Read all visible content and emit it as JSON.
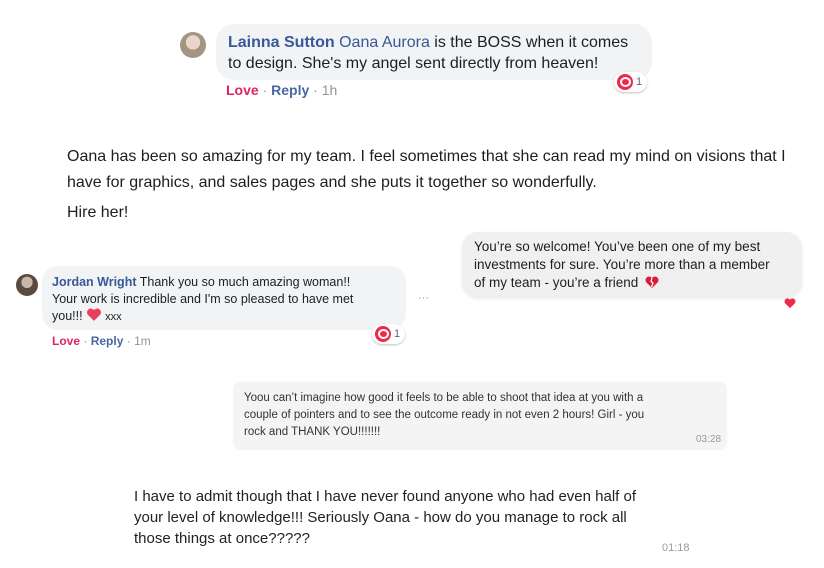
{
  "comment1": {
    "author": "Lainna Sutton",
    "mention": "Oana Aurora",
    "text_line1_rest": " is the BOSS when it comes",
    "text_line2": "to design. She's my angel sent directly from heaven!",
    "actions": {
      "love": "Love",
      "reply": "Reply",
      "time": "1h"
    },
    "reaction_count": "1"
  },
  "testimonial": {
    "line1": "Oana has been so amazing for my team. I feel sometimes that she can read my mind on visions that I",
    "line2": "have for graphics, and sales pages and she puts it together so wonderfully.",
    "line3": "Hire her!"
  },
  "reply_bubble": {
    "line1": "You’re so welcome!  You’ve been one of my best",
    "line2": "investments for sure.  You’re more than a member",
    "line3": "of my team - you’re a friend"
  },
  "comment2": {
    "author": "Jordan Wright",
    "text_line1_rest": " Thank you so much amazing woman!!",
    "text_line2": "Your work is incredible and I'm so pleased to have met",
    "text_line3": "you!!!",
    "text_line3_tail": " xxx",
    "ellipsis": "···",
    "actions": {
      "love": "Love",
      "reply": "Reply",
      "time": "1m"
    },
    "reaction_count": "1"
  },
  "message1": {
    "line1": "Yoou can’t imagine how good it feels to be able to shoot that idea at you with a",
    "line2": "couple of pointers and to see the outcome ready in not even 2 hours! Girl - you",
    "line3": "rock and THANK YOU!!!!!!!",
    "time": "03:28"
  },
  "message2": {
    "line1": "I have to admit though that I have never found anyone who had even half of",
    "line2": "your level of knowledge!!! Seriously Oana - how do you manage to rock all",
    "line3": "those things at once?????",
    "time": "01:18"
  },
  "colors": {
    "link": "#385898",
    "love": "#e0245e",
    "heart": "#f0284a"
  },
  "icons": [
    "heart-reaction-icon",
    "heart-emoji-icon",
    "broken-heart-emoji-icon",
    "avatar"
  ]
}
